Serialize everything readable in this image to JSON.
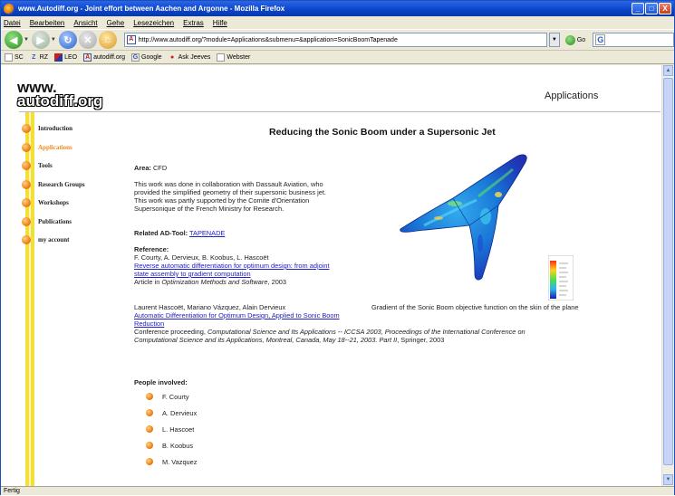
{
  "window": {
    "title": "www.Autodiff.org - Joint effort between Aachen and Argonne - Mozilla Firefox",
    "buttons": {
      "minimize": "_",
      "maximize": "□",
      "close": "X"
    }
  },
  "menu": [
    "Datei",
    "Bearbeiten",
    "Ansicht",
    "Gehe",
    "Lesezeichen",
    "Extras",
    "Hilfe"
  ],
  "navbar": {
    "url": "http://www.autodiff.org/?module=Applications&submenu=&application=SonicBoomTapenade",
    "go_label": "Go",
    "search_engine": "G"
  },
  "bookmarks": [
    {
      "icon": "page-icon",
      "label": "SC"
    },
    {
      "icon": "z-icon",
      "label": "RZ"
    },
    {
      "icon": "flag-icon",
      "label": "LEO"
    },
    {
      "icon": "ad-icon",
      "label": "autodiff.org"
    },
    {
      "icon": "google-icon",
      "label": "Google"
    },
    {
      "icon": "jeeves-icon",
      "label": "Ask Jeeves"
    },
    {
      "icon": "page-icon",
      "label": "Webster"
    }
  ],
  "status": "Fertig",
  "site": {
    "logo_line1": "www.",
    "logo_line2": "autodiff.org",
    "section": "Applications",
    "nav": [
      {
        "label": "Introduction",
        "active": false
      },
      {
        "label": "Applications",
        "active": true
      },
      {
        "label": "Tools",
        "active": false
      },
      {
        "label": "Research Groups",
        "active": false
      },
      {
        "label": "Workshops",
        "active": false
      },
      {
        "label": "Publications",
        "active": false
      },
      {
        "label": "my account",
        "active": false
      }
    ],
    "accent": "#f08a1a"
  },
  "article": {
    "title": "Reducing the Sonic Boom under a Supersonic Jet",
    "area_label": "Area:",
    "area_value": "CFD",
    "desc_lines": [
      "This work was done in collaboration with Dassault Aviation, who",
      "provided the simplified geometry of their supersonic business jet.",
      "This work was partly supported by the Comite d'Orientation",
      "Supersonique of the French Ministry for Research."
    ],
    "tool_label": "Related AD-Tool:",
    "tool_value": "TAPENADE",
    "reference_label": "Reference:",
    "ref1": {
      "authors": "F. Courty, A. Dervieux, B. Koobus, L. Hascoët",
      "link_line1": "Reverse automatic differentiation for optimum design: from adjoint",
      "link_line2": "state assembly to gradient computation",
      "pub_prefix": "Article in ",
      "pub_journal": "Optimization Methods and Software",
      "pub_suffix": ", 2003"
    },
    "ref2": {
      "authors": "Laurent Hascoët, Mariano Vázquez, Alain Dervieux",
      "link_line1": "Automatic Differentiation for Optimum Design, Applied to Sonic Boom",
      "link_line2": "Reduction",
      "pub_prefix": "Conference proceeding, ",
      "pub_line1_it": "Computational Science and Its Applications -- ICCSA 2003, Proceedings of the International Conference on",
      "pub_line2_it": "Computational Science and its Applications, Montreal, Canada, May 18--21, 2003. Part II",
      "pub_suffix": ", Springer, 2003"
    },
    "figure_caption": "Gradient of the Sonic Boom objective function on the skin of the plane",
    "people_label": "People involved:",
    "people": [
      "F. Courty",
      "A. Dervieux",
      "L. Hascoet",
      "B. Koobus",
      "M. Vazquez"
    ]
  }
}
